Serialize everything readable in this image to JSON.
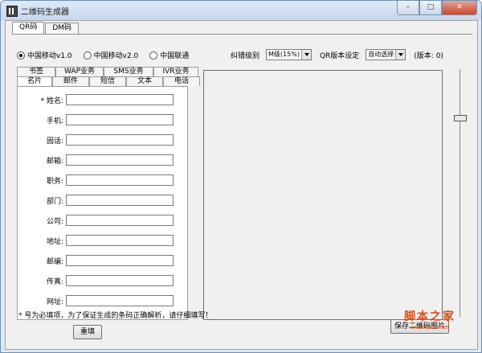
{
  "window": {
    "title": "二维码生成器",
    "buttons": {
      "min": "–",
      "max": "□",
      "close": "✕"
    }
  },
  "top_tabs": [
    {
      "label": "QR码"
    },
    {
      "label": "DM码"
    }
  ],
  "version_radios": [
    {
      "label": "中国移动v1.0",
      "selected": true
    },
    {
      "label": "中国移动v2.0",
      "selected": false
    },
    {
      "label": "中国联通",
      "selected": false
    }
  ],
  "error_correction": {
    "label": "纠错级别",
    "value": "M级(15%)"
  },
  "qr_version": {
    "label": "QR版本设定",
    "value": "自动选择",
    "readout": "(版本: 0)"
  },
  "sub_tabs_row1": [
    {
      "label": "书签"
    },
    {
      "label": "WAP业务"
    },
    {
      "label": "SMS业务"
    },
    {
      "label": "IVR业务"
    }
  ],
  "sub_tabs_row2": [
    {
      "label": "名片"
    },
    {
      "label": "邮件"
    },
    {
      "label": "短信"
    },
    {
      "label": "文本"
    },
    {
      "label": "电话"
    }
  ],
  "fields": [
    {
      "label": "* 姓名:",
      "value": ""
    },
    {
      "label": "手机:",
      "value": ""
    },
    {
      "label": "固话:",
      "value": ""
    },
    {
      "label": "邮箱:",
      "value": ""
    },
    {
      "label": "职务:",
      "value": ""
    },
    {
      "label": "部门:",
      "value": ""
    },
    {
      "label": "公司:",
      "value": ""
    },
    {
      "label": "地址:",
      "value": ""
    },
    {
      "label": "邮编:",
      "value": ""
    },
    {
      "label": "传真:",
      "value": ""
    },
    {
      "label": "网址:",
      "value": ""
    }
  ],
  "note": "* 号为必填项，为了保证生成的条码正确解析，请仔细填写！",
  "buttons": {
    "reset": "重填",
    "save_image": "保存二维码图片"
  },
  "watermark": {
    "big": "脚本之家",
    "small": "www.jb51.net"
  },
  "colors": {
    "watermark": "#e04b16",
    "title_bar": "#c6d8ec"
  }
}
